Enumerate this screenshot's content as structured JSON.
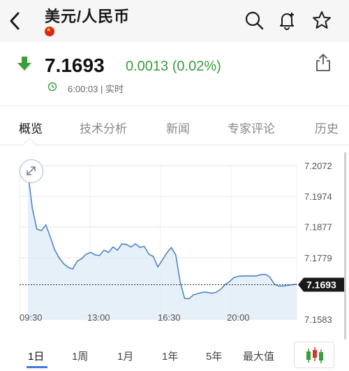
{
  "header": {
    "title": "美元/人民币",
    "icons": [
      "back-chevron-icon",
      "search-icon",
      "add-alert-bell-icon",
      "star-icon"
    ]
  },
  "quote": {
    "price": "7.1693",
    "change": "0.0013 (0.02%)",
    "time": "6:00:03 | 实时",
    "colors": {
      "down": "#3a9d3a",
      "line": "#4c86c6",
      "fill": "#dce9f7"
    }
  },
  "tabs": [
    {
      "label": "概览",
      "active": true
    },
    {
      "label": "技术分析",
      "active": false
    },
    {
      "label": "新闻",
      "active": false
    },
    {
      "label": "专家评论",
      "active": false
    },
    {
      "label": "历史",
      "active": false
    }
  ],
  "chart_data": {
    "type": "area",
    "x_ticks": [
      "09:30",
      "13:00",
      "16:30",
      "20:00"
    ],
    "y_ticks": [
      "7.2072",
      "7.1974",
      "7.1877",
      "7.1779",
      "7.1583"
    ],
    "ylim": [
      7.1583,
      7.2072
    ],
    "last_value_label": "7.1693",
    "last_value": 7.1693,
    "series": [
      {
        "values": [
          7.205,
          7.1935,
          7.187,
          7.1865,
          7.1883,
          7.1845,
          7.1803,
          7.1778,
          7.176,
          7.1748,
          7.1743,
          7.1768,
          7.1776,
          7.179,
          7.1796,
          7.1788,
          7.1786,
          7.1803,
          7.1796,
          7.1813,
          7.1803,
          7.1823,
          7.1821,
          7.1813,
          7.1823,
          7.1812,
          7.1815,
          7.179,
          7.1783,
          7.175,
          7.1771,
          7.1794,
          7.1811,
          7.1788,
          7.1701,
          7.1649,
          7.1649,
          7.1661,
          7.1665,
          7.1669,
          7.1669,
          7.1666,
          7.1669,
          7.1678,
          7.1693,
          7.1703,
          7.1716,
          7.172,
          7.1721,
          7.1721,
          7.1721,
          7.1721,
          7.1725,
          7.1726,
          7.1718,
          7.1695,
          7.1689,
          7.1689,
          7.1691,
          7.1693,
          7.1695
        ]
      }
    ],
    "grid": true
  },
  "periods": [
    {
      "label": "1日",
      "active": true
    },
    {
      "label": "1周",
      "active": false
    },
    {
      "label": "1月",
      "active": false
    },
    {
      "label": "1年",
      "active": false
    },
    {
      "label": "5年",
      "active": false
    },
    {
      "label": "最大值",
      "active": false
    }
  ],
  "controls": {
    "expand_icon": "expand-arrows-icon",
    "chart_type_icon": "candlestick-icon"
  }
}
